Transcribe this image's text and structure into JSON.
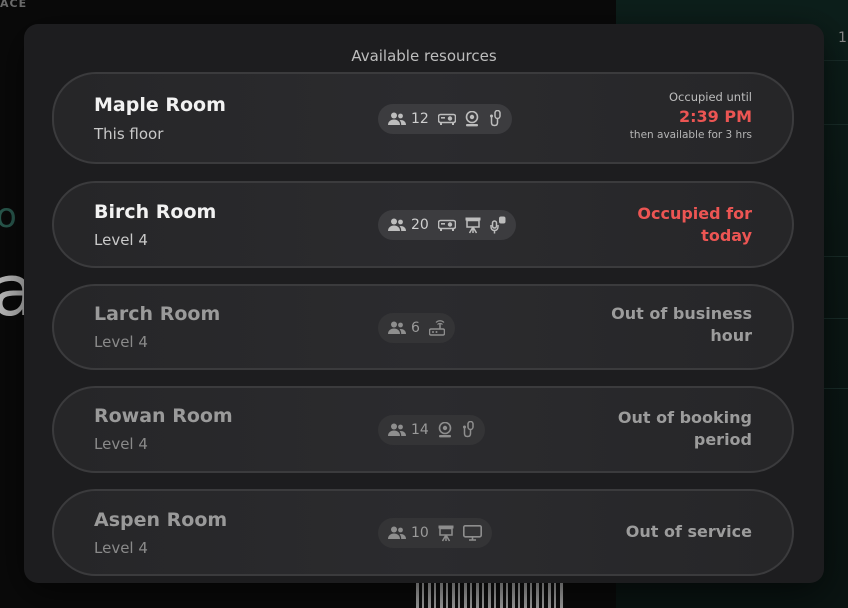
{
  "background": {
    "corner_text": "ACE",
    "right_number": "1",
    "char_1": "o",
    "char_2": "a"
  },
  "modal": {
    "title": "Available resources"
  },
  "resources": [
    {
      "name": "Maple Room",
      "location": "This floor",
      "capacity": "12",
      "amenities": [
        "projector-icon",
        "webcam-icon",
        "microphone-icon"
      ],
      "status_line1": "Occupied until",
      "status_time": "2:39 PM",
      "status_line3": "then available for 3 hrs"
    },
    {
      "name": "Birch Room",
      "location": "Level 4",
      "capacity": "20",
      "amenities": [
        "projector-icon",
        "presentation-icon",
        "wireless-mic-icon"
      ],
      "status": "Occupied for today"
    },
    {
      "name": "Larch Room",
      "location": "Level 4",
      "capacity": "6",
      "amenities": [
        "router-icon"
      ],
      "status": "Out of business hour"
    },
    {
      "name": "Rowan Room",
      "location": "Level 4",
      "capacity": "14",
      "amenities": [
        "webcam-icon",
        "microphone-icon"
      ],
      "status": "Out of booking period"
    },
    {
      "name": "Aspen Room",
      "location": "Level 4",
      "capacity": "10",
      "amenities": [
        "presentation-icon",
        "monitor-icon"
      ],
      "status": "Out of service"
    }
  ],
  "colors": {
    "accent_red": "#ec5553",
    "modal_bg": "#1d1d1f",
    "card_bg": "#2a2a2d"
  }
}
